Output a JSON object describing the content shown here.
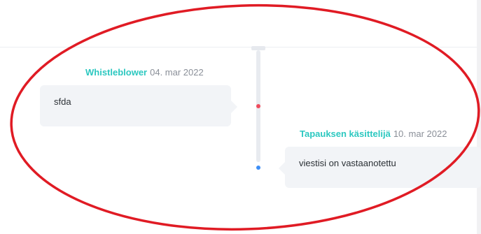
{
  "messages": [
    {
      "author": "Whistleblower",
      "date": "04. mar 2022",
      "text": "sfda",
      "marker_color": "#ef4b5c"
    },
    {
      "author": "Tapauksen käsittelijä",
      "date": "10. mar 2022",
      "text": "viestisi on vastaanotettu",
      "marker_color": "#3d8ef6"
    }
  ],
  "colors": {
    "author": "#2cc8c0",
    "date": "#8a8f98",
    "bubble_bg": "#f2f4f7",
    "annotation": "#e01b24"
  },
  "annotation": {
    "shape": "ellipse",
    "color": "#e01b24"
  }
}
